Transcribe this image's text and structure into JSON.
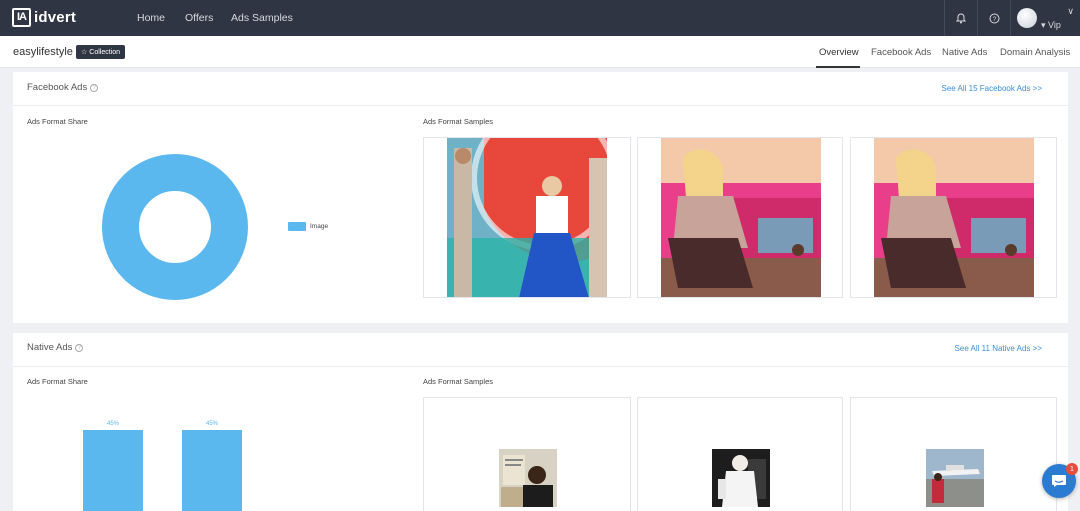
{
  "nav": {
    "logo_mark": "IA",
    "logo_text": "idvert",
    "links": [
      "Home",
      "Offers",
      "Ads Samples"
    ],
    "user_level": "Vip"
  },
  "subheader": {
    "site_name": "easylifestyle",
    "collection_label": "Collection",
    "tabs": [
      "Overview",
      "Facebook Ads",
      "Native Ads",
      "Domain Analysis"
    ],
    "active_tab": "Overview"
  },
  "facebook_ads": {
    "title": "Facebook Ads",
    "see_all": "See All 15 Facebook Ads >>",
    "format_share_label": "Ads Format Share",
    "format_samples_label": "Ads Format Samples",
    "legend": "Image",
    "chart_color": "#5bb8ee"
  },
  "native_ads": {
    "title": "Native Ads",
    "see_all": "See All 11 Native Ads >>",
    "format_share_label": "Ads Format Share",
    "format_samples_label": "Ads Format Samples"
  },
  "chart_data": [
    {
      "type": "pie",
      "categories": [
        "Image"
      ],
      "values": [
        100
      ],
      "title": "",
      "legend": "right"
    },
    {
      "type": "bar",
      "categories": [
        "",
        ""
      ],
      "values": [
        45,
        45
      ],
      "value_labels": [
        "45%",
        "45%"
      ],
      "title": ""
    }
  ],
  "colors": {
    "nav_bg": "#2f3542",
    "accent": "#5bb8ee",
    "link": "#3a8fd9",
    "chat": "#2a7bd1",
    "badge": "#e74c3c"
  },
  "chat": {
    "badge_count": "1"
  }
}
